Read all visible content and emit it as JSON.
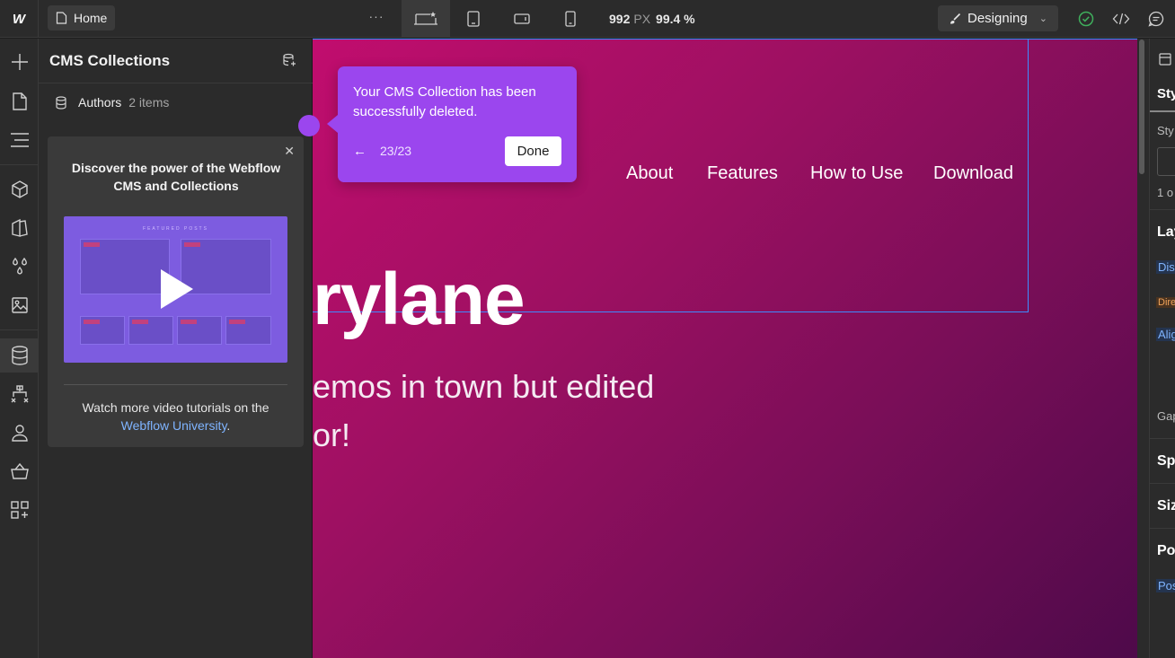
{
  "topbar": {
    "logo": "W",
    "page_label": "Home",
    "more": "···",
    "width_value": "992",
    "width_unit": "PX",
    "zoom": "99.4 %",
    "mode_label": "Designing",
    "colors": {
      "bg": "#2b2b2b",
      "status_ok": "#3fae5c"
    }
  },
  "panel": {
    "title": "CMS Collections",
    "collections": [
      {
        "name": "Authors",
        "count": "2 items"
      }
    ],
    "promo": {
      "title": "Discover the power of the Webflow CMS and Collections",
      "video_caption": "FEATURED POSTS",
      "footer_text": "Watch more video tutorials on the",
      "footer_link": "Webflow University",
      "footer_end": "."
    }
  },
  "tooltip": {
    "message": "Your CMS Collection has been successfully deleted.",
    "progress": "23/23",
    "done_label": "Done",
    "color": "#9b46ee"
  },
  "canvas": {
    "nav": [
      "About",
      "Features",
      "How to Use",
      "Download"
    ],
    "hero_title": "rylane",
    "hero_line1": "emos in town but edited",
    "hero_line2": "or!",
    "gradient": [
      "#c10d6e",
      "#4e0a4a"
    ]
  },
  "right_panel": {
    "tab": "Sty",
    "style_label": "Sty",
    "count": "1 o",
    "layout": "Lay",
    "display": "Dis",
    "direction": "Dire",
    "align": "Alig",
    "gap": "Gap",
    "spacing": "Sp",
    "size": "Siz",
    "position": "Po",
    "position_label": "Pos"
  }
}
